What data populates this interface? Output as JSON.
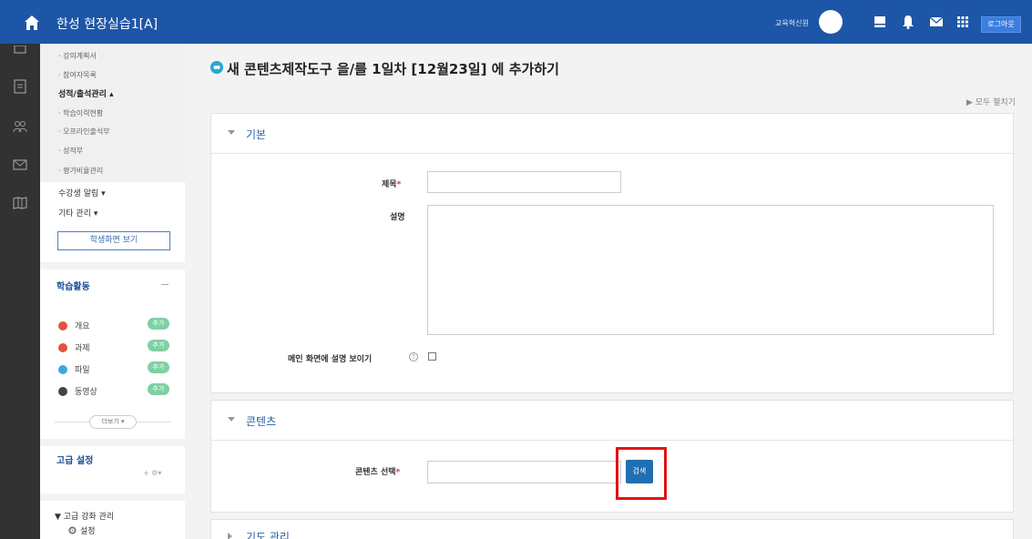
{
  "topbar": {
    "site_title": "한성 현장실습1[A]",
    "user_name": "교육혁신원",
    "logout_label": "로그아웃",
    "bg_color": "#1d56a6"
  },
  "rail": {
    "icons": [
      "calendar-icon",
      "board-icon",
      "people-icon",
      "mail-icon",
      "book-icon"
    ]
  },
  "sidebar": {
    "items": [
      {
        "label": "· 강의계획서"
      },
      {
        "label": "· 참여자목록"
      },
      {
        "label": "성적/출석관리 ▴"
      },
      {
        "label": "· 학습이력현황"
      },
      {
        "label": "· 오프라인출석부"
      },
      {
        "label": "· 성적부"
      },
      {
        "label": "· 평가비율관리"
      },
      {
        "label": "수강생 알림 ▾"
      },
      {
        "label": "기타 관리 ▾"
      }
    ],
    "student_view_label": "학생화면 보기",
    "activities_title": "학습활동",
    "activities": [
      {
        "label": "개요",
        "badge": "추가",
        "color": "#e0533d"
      },
      {
        "label": "과제",
        "badge": "추가",
        "color": "#e0533d"
      },
      {
        "label": "파일",
        "badge": "추가",
        "color": "#41a6de"
      },
      {
        "label": "동영상",
        "badge": "추가",
        "color": "#444444"
      }
    ],
    "more_label": "더보기 ▾",
    "advanced_title": "고급 설정",
    "gear_controls": "+ ⚙▾",
    "advanced_manage": "▼ 고급 강좌 관리",
    "settings_label": "설정"
  },
  "main": {
    "page_title": "새 콘텐츠제작도구 을/를 1일차 [12월23일] 에 추가하기",
    "expand_all": "▶ 모두 펼치기",
    "basic_section": "기본",
    "title_label": "제목",
    "required_mark": "*",
    "desc_label": "설명",
    "show_desc_label": "메인 화면에 설명 보이기",
    "help_glyph": "?",
    "content_section": "콘텐츠",
    "content_select_label": "콘텐츠 선택",
    "search_label": "검색",
    "next_section": "기도 관리",
    "accent_color": "#1f6fb3",
    "highlight_color": "#e01515"
  }
}
